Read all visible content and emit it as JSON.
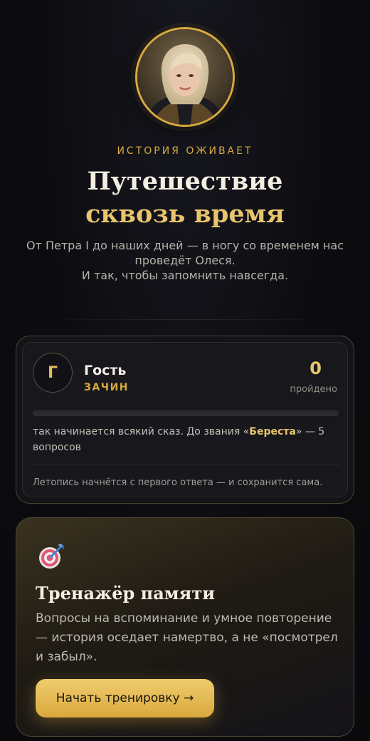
{
  "hero": {
    "eyebrow": "ИСТОРИЯ ОЖИВАЕТ",
    "title_line1": "Путешествие",
    "title_line2": "сквозь время",
    "subtitle_line1": "От Петра I до наших дней — в ногу со временем нас проведёт Олеся.",
    "subtitle_line2": "И так, чтобы запомнить навсегда."
  },
  "profile": {
    "initial": "Г",
    "name": "Гость",
    "rank": "ЗАЧИН",
    "completed_count": "0",
    "completed_label": "пройдено",
    "progress_fraction": 0,
    "progress_text_before": "так начинается всякий сказ. До звания «",
    "next_rank": "Береста",
    "progress_text_after": "» — 5 вопросов",
    "note": "Летопись начнётся с первого ответа — и сохранится сама."
  },
  "trainer": {
    "icon": "target-icon",
    "title": "Тренажёр памяти",
    "description": "Вопросы на вспоминание и умное повторение — история оседает намертво, а не «посмотрел и забыл».",
    "button_label": "Начать тренировку →"
  },
  "colors": {
    "accent": "#d7a93f",
    "accent_light": "#e8c46c",
    "background": "#0c0c10"
  }
}
